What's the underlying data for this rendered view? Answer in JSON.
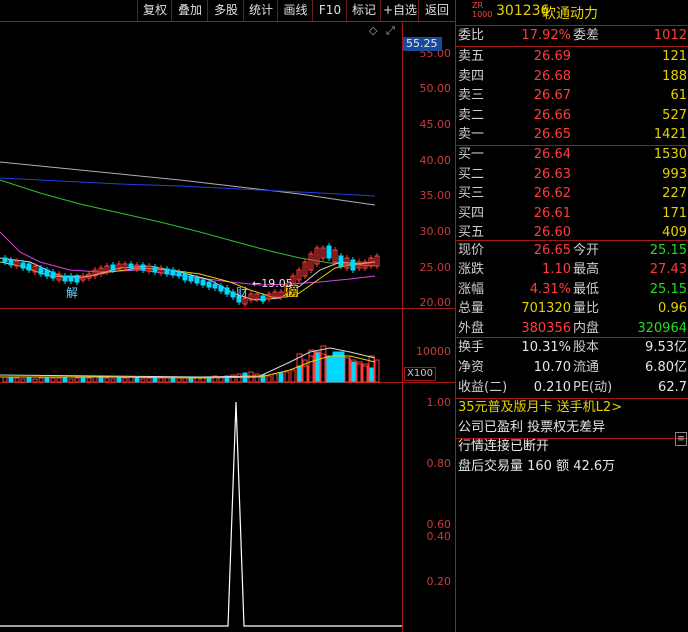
{
  "toolbar": {
    "buttons": [
      "复权",
      "叠加",
      "多股",
      "统计",
      "画线",
      "F10",
      "标记",
      "+自选",
      "返回"
    ]
  },
  "chart": {
    "price_ticks": [
      "55.00",
      "50.00",
      "45.00",
      "40.00",
      "35.00",
      "30.00",
      "25.00",
      "20.00"
    ],
    "current_price_tag": "55.25",
    "low_marker": "19.05",
    "event_labels": [
      "解",
      "财",
      "榜"
    ],
    "volume_tick": "10000",
    "volume_unit": "X100",
    "indicator_ticks": [
      "1.00",
      "0.80",
      "0.60",
      "0.40",
      "0.20"
    ],
    "colors": {
      "up": "#ff3c3c",
      "down": "#00d8ff",
      "ma_white": "#d8d8d8",
      "ma_yellow": "#e6d200",
      "ma_magenta": "#e040e0",
      "ma_green": "#30c030",
      "ma_blue": "#2040e0",
      "ma_gray": "#b0b0b0"
    }
  },
  "quote": {
    "badge_top": "ZR",
    "badge_bottom": "1000",
    "code": "301236",
    "name": "软通动力",
    "weibi_label": "委比",
    "weibi": "17.92%",
    "weicha_label": "委差",
    "weicha": "1012",
    "asks": [
      {
        "label": "卖五",
        "price": "26.69",
        "vol": "121"
      },
      {
        "label": "卖四",
        "price": "26.68",
        "vol": "188"
      },
      {
        "label": "卖三",
        "price": "26.67",
        "vol": "61"
      },
      {
        "label": "卖二",
        "price": "26.66",
        "vol": "527"
      },
      {
        "label": "卖一",
        "price": "26.65",
        "vol": "1421"
      }
    ],
    "bids": [
      {
        "label": "买一",
        "price": "26.64",
        "vol": "1530"
      },
      {
        "label": "买二",
        "price": "26.63",
        "vol": "993"
      },
      {
        "label": "买三",
        "price": "26.62",
        "vol": "227"
      },
      {
        "label": "买四",
        "price": "26.61",
        "vol": "171"
      },
      {
        "label": "买五",
        "price": "26.60",
        "vol": "409"
      }
    ],
    "stats": [
      {
        "l1": "现价",
        "v1": "26.65",
        "c1": "red",
        "l2": "今开",
        "v2": "25.15",
        "c2": "green"
      },
      {
        "l1": "涨跌",
        "v1": "1.10",
        "c1": "red",
        "l2": "最高",
        "v2": "27.43",
        "c2": "red"
      },
      {
        "l1": "涨幅",
        "v1": "4.31%",
        "c1": "red",
        "l2": "最低",
        "v2": "25.15",
        "c2": "green"
      },
      {
        "l1": "总量",
        "v1": "701320",
        "c1": "yellow",
        "l2": "量比",
        "v2": "0.96",
        "c2": "yellow"
      },
      {
        "l1": "外盘",
        "v1": "380356",
        "c1": "red",
        "l2": "内盘",
        "v2": "320964",
        "c2": "green"
      }
    ],
    "fin": [
      {
        "l1": "换手",
        "v1": "10.31%",
        "l2": "股本",
        "v2": "9.53亿"
      },
      {
        "l1": "净资",
        "v1": "10.70",
        "l2": "流通",
        "v2": "6.80亿"
      },
      {
        "l1": "收益(二)",
        "v1": "0.210",
        "l2": "PE(动)",
        "v2": "62.7"
      }
    ],
    "promo": "35元普及版月卡 送手机L2>",
    "notice1": "公司已盈利 投票权无差异",
    "notice2": "行情连接已断开",
    "after_hours": "盘后交易量 160 额 42.6万"
  }
}
